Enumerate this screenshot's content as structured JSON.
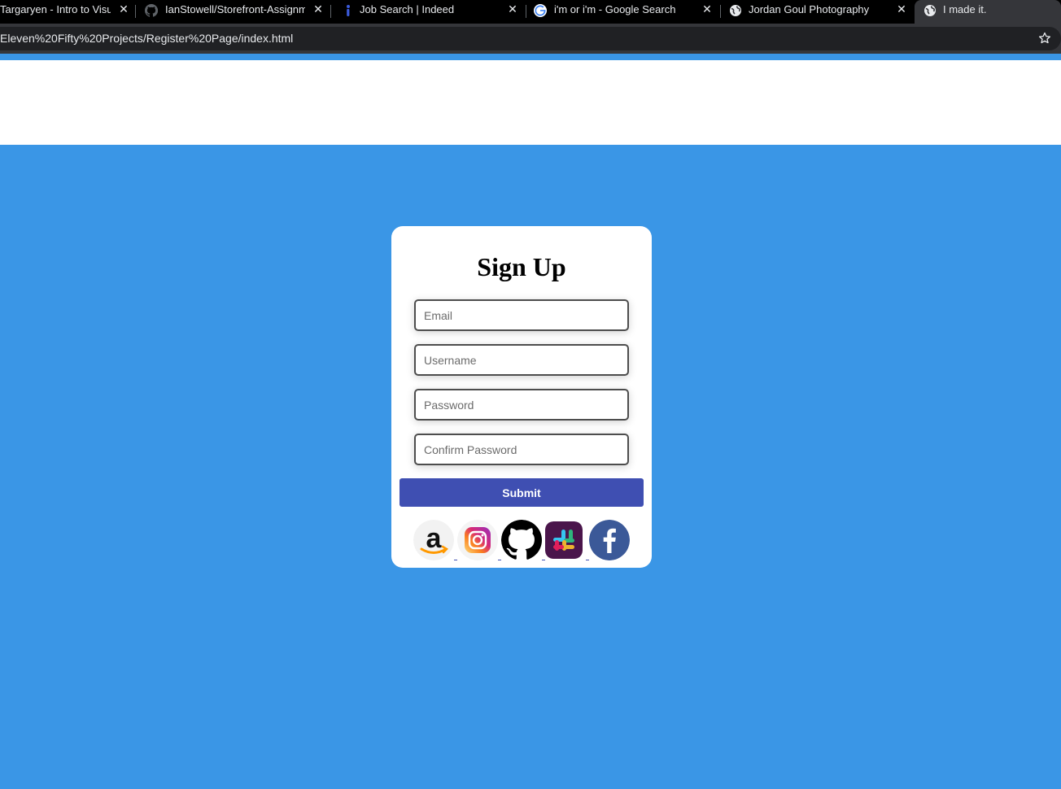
{
  "browser": {
    "tabs": [
      {
        "title": "Targaryen - Intro to Visual",
        "favicon": "none",
        "active": false
      },
      {
        "title": "IanStowell/Storefront-Assignment",
        "favicon": "github-icon",
        "active": false
      },
      {
        "title": "Job Search | Indeed",
        "favicon": "indeed-icon",
        "active": false
      },
      {
        "title": "i'm or i'm - Google Search",
        "favicon": "google-icon",
        "active": false
      },
      {
        "title": "Jordan Goul Photography",
        "favicon": "globe-icon",
        "active": false
      },
      {
        "title": "I made it.",
        "favicon": "globe-icon",
        "active": true
      }
    ],
    "close_glyph": "✕",
    "url": "Eleven%20Fifty%20Projects/Register%20Page/index.html"
  },
  "colors": {
    "page_background": "#3a96e6",
    "submit_button": "#3f4fb2"
  },
  "signup": {
    "heading": "Sign Up",
    "fields": {
      "email_placeholder": "Email",
      "username_placeholder": "Username",
      "password_placeholder": "Password",
      "confirm_password_placeholder": "Confirm Password"
    },
    "submit_label": "Submit",
    "social_links": [
      {
        "name": "amazon-icon"
      },
      {
        "name": "instagram-icon"
      },
      {
        "name": "github-icon"
      },
      {
        "name": "slack-icon"
      },
      {
        "name": "facebook-icon"
      }
    ]
  }
}
